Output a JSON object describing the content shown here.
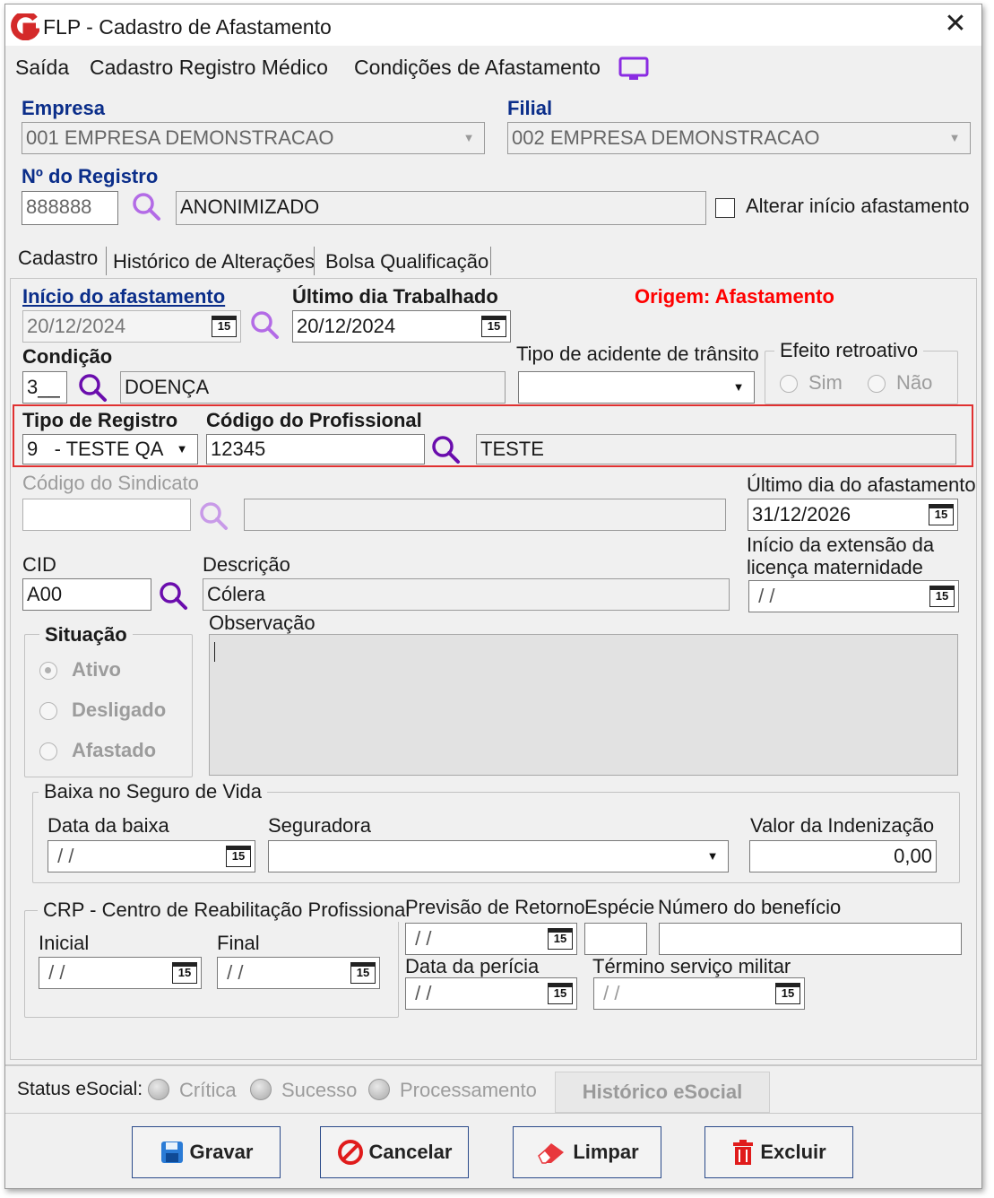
{
  "window": {
    "title": "FLP - Cadastro de Afastamento"
  },
  "menu": {
    "items": [
      "Saída",
      "Cadastro Registro Médico",
      "Condições de Afastamento"
    ]
  },
  "empresa": {
    "label": "Empresa",
    "value": "001 EMPRESA DEMONSTRACAO"
  },
  "filial": {
    "label": "Filial",
    "value": "002 EMPRESA DEMONSTRACAO"
  },
  "registro": {
    "label": "Nº do Registro",
    "number": "888888",
    "name": "ANONIMIZADO"
  },
  "alterar_inicio": {
    "label": "Alterar início afastamento",
    "checked": false
  },
  "tabs": [
    "Cadastro",
    "Histórico de Alterações",
    "Bolsa Qualificação"
  ],
  "inicio_afastamento": {
    "label": "Início do afastamento",
    "value": "20/12/2024"
  },
  "ultimo_dia_trabalhado": {
    "label": "Último dia Trabalhado",
    "value": "20/12/2024"
  },
  "origem": {
    "label": "Origem: Afastamento"
  },
  "condicao": {
    "label": "Condição",
    "code": "3__",
    "description": "DOENÇA"
  },
  "tipo_acidente": {
    "label": "Tipo de acidente de trânsito",
    "value": ""
  },
  "efeito_retroativo": {
    "label": "Efeito retroativo",
    "options": [
      "Sim",
      "Não"
    ]
  },
  "tipo_registro": {
    "label": "Tipo de Registro",
    "value": "9   - TESTE QA"
  },
  "codigo_profissional": {
    "label": "Código do Profissional",
    "code": "12345",
    "name": "TESTE"
  },
  "codigo_sindicato": {
    "label": "Código do Sindicato",
    "code": "",
    "name": ""
  },
  "ultimo_dia_afastamento": {
    "label": "Último dia do afastamento",
    "value": "31/12/2026"
  },
  "inicio_extensao": {
    "label_line1": "Início da extensão da",
    "label_line2": "licença maternidade",
    "value": " / /"
  },
  "cid": {
    "label": "CID",
    "value": "A00"
  },
  "descricao": {
    "label": "Descrição",
    "value": "Cólera"
  },
  "observacao": {
    "label": "Observação",
    "value": ""
  },
  "situacao": {
    "label": "Situação",
    "options": [
      "Ativo",
      "Desligado",
      "Afastado"
    ],
    "selected": "Ativo"
  },
  "seguro_vida": {
    "title": "Baixa no Seguro de Vida",
    "data_baixa_label": "Data da baixa",
    "data_baixa": " / /",
    "seguradora_label": "Seguradora",
    "seguradora": "",
    "valor_label": "Valor da Indenização",
    "valor": "0,00"
  },
  "crp": {
    "title": "CRP - Centro de Reabilitação Profissional",
    "inicial_label": "Inicial",
    "inicial": " / /",
    "final_label": "Final",
    "final": " / /"
  },
  "previsao_retorno": {
    "label": "Previsão de Retorno",
    "value": " / /"
  },
  "especie": {
    "label": "Espécie",
    "value": ""
  },
  "numero_beneficio": {
    "label": "Número do benefício",
    "value": ""
  },
  "data_pericia": {
    "label": "Data da perícia",
    "value": " / /"
  },
  "termino_servico_militar": {
    "label": "Término serviço militar",
    "value": " / /"
  },
  "status_esocial": {
    "label": "Status eSocial:",
    "options": [
      "Crítica",
      "Sucesso",
      "Processamento"
    ],
    "history_button": "Histórico eSocial"
  },
  "buttons": {
    "gravar": "Gravar",
    "cancelar": "Cancelar",
    "limpar": "Limpar",
    "excluir": "Excluir"
  },
  "calendar_icon_text": "15",
  "colors": {
    "label_blue": "#0b2e8a",
    "origin_red": "#ff0000",
    "highlight": "#e03030",
    "purple_icon": "#8a2be2"
  }
}
